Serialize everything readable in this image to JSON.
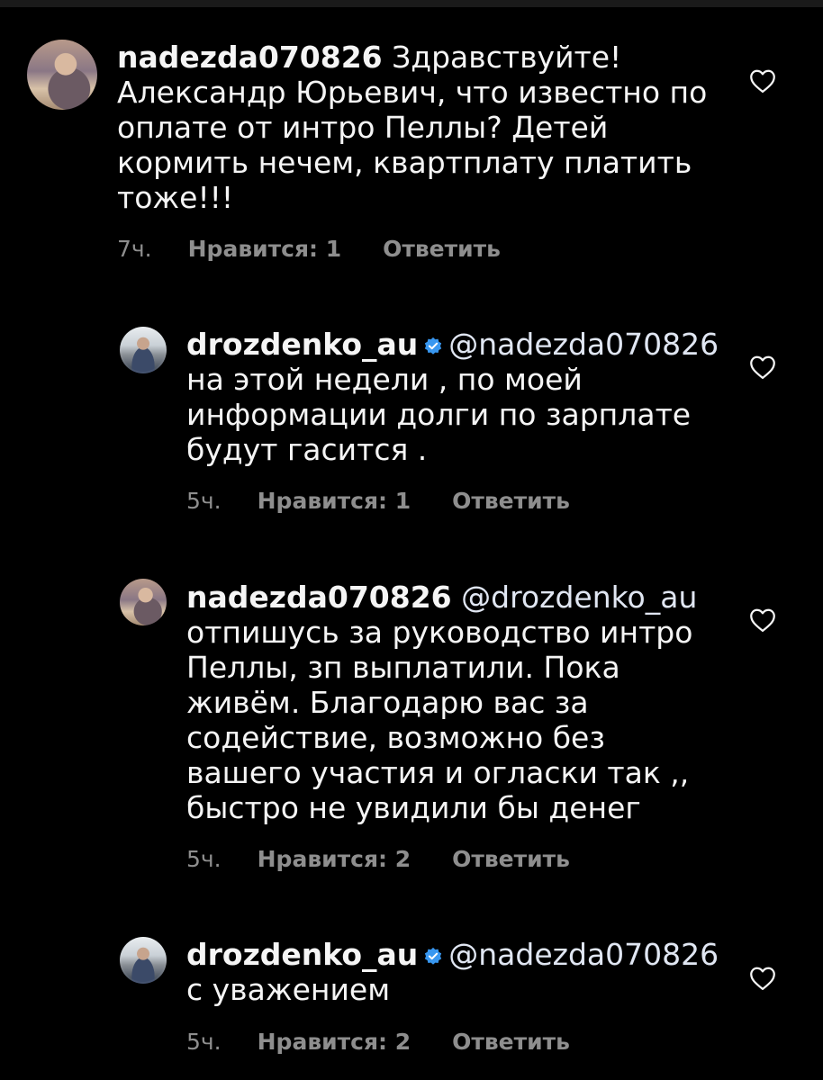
{
  "colors": {
    "background": "#000000",
    "text": "#f5f5f5",
    "meta": "#8e8e8e",
    "verified": "#3897f0"
  },
  "comments": [
    {
      "username": "nadezda070826",
      "verified": false,
      "mention": "",
      "text": "Здравствуйте!\nАлександр Юрьевич, что известно по\nоплате от интро Пеллы? Детей\nкормить нечем, квартплату платить\nтоже!!!",
      "time": "7ч.",
      "likes": "Нравится: 1",
      "reply": "Ответить",
      "like_icon": "heart-outline-icon"
    },
    {
      "username": "drozdenko_au",
      "verified": true,
      "mention": "@nadezda070826",
      "text": "на этой недели , по моей\nинформации долги по зарплате\nбудут гасится .",
      "time": "5ч.",
      "likes": "Нравится: 1",
      "reply": "Ответить",
      "like_icon": "heart-outline-icon"
    },
    {
      "username": "nadezda070826",
      "verified": false,
      "mention": "@drozdenko_au",
      "text": "отпишусь за руководство интро\nПеллы, зп выплатили. Пока\nживём. Благодарю вас за\nсодействие, возможно без\nвашего участия и огласки так ,,\nбыстро не увидили бы денег",
      "time": "5ч.",
      "likes": "Нравится: 2",
      "reply": "Ответить",
      "like_icon": "heart-outline-icon"
    },
    {
      "username": "drozdenko_au",
      "verified": true,
      "mention": "@nadezda070826",
      "text": "с уважением",
      "time": "5ч.",
      "likes": "Нравится: 2",
      "reply": "Ответить",
      "like_icon": "heart-outline-icon"
    }
  ]
}
